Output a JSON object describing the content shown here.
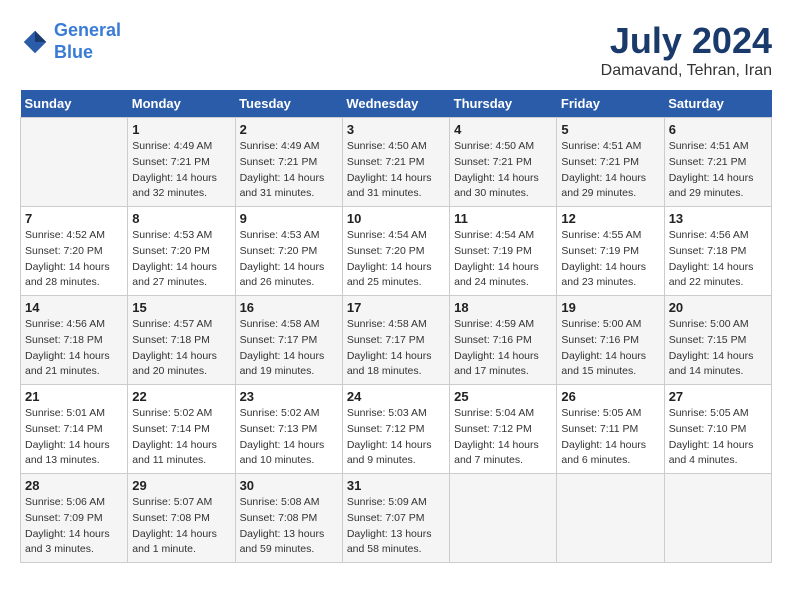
{
  "header": {
    "logo_line1": "General",
    "logo_line2": "Blue",
    "month": "July 2024",
    "location": "Damavand, Tehran, Iran"
  },
  "weekdays": [
    "Sunday",
    "Monday",
    "Tuesday",
    "Wednesday",
    "Thursday",
    "Friday",
    "Saturday"
  ],
  "weeks": [
    [
      {
        "day": "",
        "info": ""
      },
      {
        "day": "1",
        "info": "Sunrise: 4:49 AM\nSunset: 7:21 PM\nDaylight: 14 hours\nand 32 minutes."
      },
      {
        "day": "2",
        "info": "Sunrise: 4:49 AM\nSunset: 7:21 PM\nDaylight: 14 hours\nand 31 minutes."
      },
      {
        "day": "3",
        "info": "Sunrise: 4:50 AM\nSunset: 7:21 PM\nDaylight: 14 hours\nand 31 minutes."
      },
      {
        "day": "4",
        "info": "Sunrise: 4:50 AM\nSunset: 7:21 PM\nDaylight: 14 hours\nand 30 minutes."
      },
      {
        "day": "5",
        "info": "Sunrise: 4:51 AM\nSunset: 7:21 PM\nDaylight: 14 hours\nand 29 minutes."
      },
      {
        "day": "6",
        "info": "Sunrise: 4:51 AM\nSunset: 7:21 PM\nDaylight: 14 hours\nand 29 minutes."
      }
    ],
    [
      {
        "day": "7",
        "info": "Sunrise: 4:52 AM\nSunset: 7:20 PM\nDaylight: 14 hours\nand 28 minutes."
      },
      {
        "day": "8",
        "info": "Sunrise: 4:53 AM\nSunset: 7:20 PM\nDaylight: 14 hours\nand 27 minutes."
      },
      {
        "day": "9",
        "info": "Sunrise: 4:53 AM\nSunset: 7:20 PM\nDaylight: 14 hours\nand 26 minutes."
      },
      {
        "day": "10",
        "info": "Sunrise: 4:54 AM\nSunset: 7:20 PM\nDaylight: 14 hours\nand 25 minutes."
      },
      {
        "day": "11",
        "info": "Sunrise: 4:54 AM\nSunset: 7:19 PM\nDaylight: 14 hours\nand 24 minutes."
      },
      {
        "day": "12",
        "info": "Sunrise: 4:55 AM\nSunset: 7:19 PM\nDaylight: 14 hours\nand 23 minutes."
      },
      {
        "day": "13",
        "info": "Sunrise: 4:56 AM\nSunset: 7:18 PM\nDaylight: 14 hours\nand 22 minutes."
      }
    ],
    [
      {
        "day": "14",
        "info": "Sunrise: 4:56 AM\nSunset: 7:18 PM\nDaylight: 14 hours\nand 21 minutes."
      },
      {
        "day": "15",
        "info": "Sunrise: 4:57 AM\nSunset: 7:18 PM\nDaylight: 14 hours\nand 20 minutes."
      },
      {
        "day": "16",
        "info": "Sunrise: 4:58 AM\nSunset: 7:17 PM\nDaylight: 14 hours\nand 19 minutes."
      },
      {
        "day": "17",
        "info": "Sunrise: 4:58 AM\nSunset: 7:17 PM\nDaylight: 14 hours\nand 18 minutes."
      },
      {
        "day": "18",
        "info": "Sunrise: 4:59 AM\nSunset: 7:16 PM\nDaylight: 14 hours\nand 17 minutes."
      },
      {
        "day": "19",
        "info": "Sunrise: 5:00 AM\nSunset: 7:16 PM\nDaylight: 14 hours\nand 15 minutes."
      },
      {
        "day": "20",
        "info": "Sunrise: 5:00 AM\nSunset: 7:15 PM\nDaylight: 14 hours\nand 14 minutes."
      }
    ],
    [
      {
        "day": "21",
        "info": "Sunrise: 5:01 AM\nSunset: 7:14 PM\nDaylight: 14 hours\nand 13 minutes."
      },
      {
        "day": "22",
        "info": "Sunrise: 5:02 AM\nSunset: 7:14 PM\nDaylight: 14 hours\nand 11 minutes."
      },
      {
        "day": "23",
        "info": "Sunrise: 5:02 AM\nSunset: 7:13 PM\nDaylight: 14 hours\nand 10 minutes."
      },
      {
        "day": "24",
        "info": "Sunrise: 5:03 AM\nSunset: 7:12 PM\nDaylight: 14 hours\nand 9 minutes."
      },
      {
        "day": "25",
        "info": "Sunrise: 5:04 AM\nSunset: 7:12 PM\nDaylight: 14 hours\nand 7 minutes."
      },
      {
        "day": "26",
        "info": "Sunrise: 5:05 AM\nSunset: 7:11 PM\nDaylight: 14 hours\nand 6 minutes."
      },
      {
        "day": "27",
        "info": "Sunrise: 5:05 AM\nSunset: 7:10 PM\nDaylight: 14 hours\nand 4 minutes."
      }
    ],
    [
      {
        "day": "28",
        "info": "Sunrise: 5:06 AM\nSunset: 7:09 PM\nDaylight: 14 hours\nand 3 minutes."
      },
      {
        "day": "29",
        "info": "Sunrise: 5:07 AM\nSunset: 7:08 PM\nDaylight: 14 hours\nand 1 minute."
      },
      {
        "day": "30",
        "info": "Sunrise: 5:08 AM\nSunset: 7:08 PM\nDaylight: 13 hours\nand 59 minutes."
      },
      {
        "day": "31",
        "info": "Sunrise: 5:09 AM\nSunset: 7:07 PM\nDaylight: 13 hours\nand 58 minutes."
      },
      {
        "day": "",
        "info": ""
      },
      {
        "day": "",
        "info": ""
      },
      {
        "day": "",
        "info": ""
      }
    ]
  ]
}
